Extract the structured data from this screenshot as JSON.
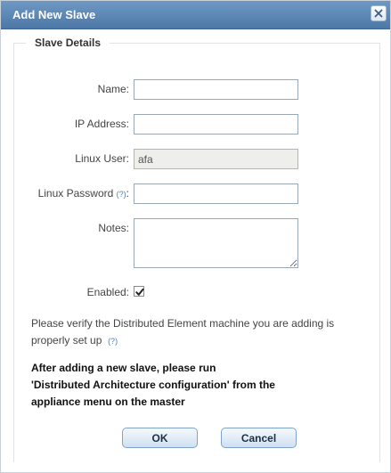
{
  "dialog": {
    "title": "Add New Slave",
    "close_icon": "close-icon"
  },
  "section": {
    "legend": "Slave Details"
  },
  "form": {
    "name_label": "Name:",
    "name_value": "",
    "ip_label": "IP Address:",
    "ip_value": "",
    "linux_user_label": "Linux User:",
    "linux_user_value": "afa",
    "linux_password_label": "Linux Password",
    "linux_password_help": "(?)",
    "linux_password_colon": ":",
    "linux_password_value": "",
    "notes_label": "Notes:",
    "notes_value": "",
    "enabled_label": "Enabled:",
    "enabled_checked": true
  },
  "messages": {
    "verify_text": "Please verify the Distributed Element machine you are adding is properly set up",
    "verify_help": "(?)",
    "notice_line1": "After adding a new slave, please run",
    "notice_line2": "'Distributed Architecture configuration' from the",
    "notice_line3": "appliance menu on the master"
  },
  "buttons": {
    "ok_label": "OK",
    "cancel_label": "Cancel"
  },
  "colors": {
    "titlebar": "#5a84b2",
    "help_link": "#4d7db3",
    "button_border": "#7fa3c8"
  }
}
